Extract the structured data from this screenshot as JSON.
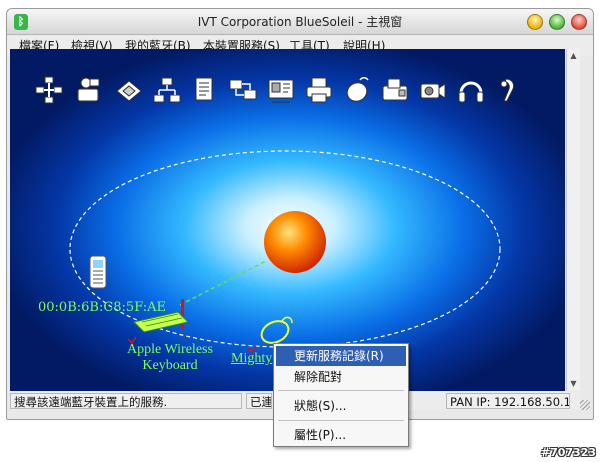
{
  "window": {
    "title": "IVT Corporation BlueSoleil - 主視窗",
    "app_icon": "bluetooth-icon"
  },
  "menu": [
    {
      "label": "檔案(F)"
    },
    {
      "label": "檢視(V)"
    },
    {
      "label": "我的藍牙(B)"
    },
    {
      "label": "本裝置服務(S)"
    },
    {
      "label": "工具(T)"
    },
    {
      "label": "說明(H)"
    }
  ],
  "toolbar": [
    {
      "name": "network-service-icon"
    },
    {
      "name": "phone-dialup-icon"
    },
    {
      "name": "file-transfer-icon"
    },
    {
      "name": "lan-access-icon"
    },
    {
      "name": "document-sync-icon"
    },
    {
      "name": "personal-area-network-icon"
    },
    {
      "name": "business-card-icon"
    },
    {
      "name": "printer-icon"
    },
    {
      "name": "mouse-hid-icon"
    },
    {
      "name": "fax-icon"
    },
    {
      "name": "camera-icon"
    },
    {
      "name": "headphones-icon"
    },
    {
      "name": "headset-icon"
    }
  ],
  "devices": {
    "phone_address": "00:0B:6B:C8:5F:AE",
    "keyboard_name_line1": "Apple Wireless",
    "keyboard_name_line2": "Keyboard",
    "mouse_name": "Mighty"
  },
  "context_menu": {
    "items": [
      {
        "label": "更新服務記錄(R)",
        "highlighted": true
      },
      {
        "label": "解除配對"
      },
      {
        "label": "狀態(S)..."
      },
      {
        "label": "屬性(P)..."
      }
    ]
  },
  "status": {
    "left": "搜尋該遠端藍牙裝置上的服務.",
    "middle": "已連",
    "right": "PAN IP: 192.168.50.1"
  },
  "colors": {
    "accent_label": "#7cff5a",
    "menu_highlight": "#2f5fb3",
    "local_device": "#ff6a00"
  },
  "watermark": "#707323"
}
